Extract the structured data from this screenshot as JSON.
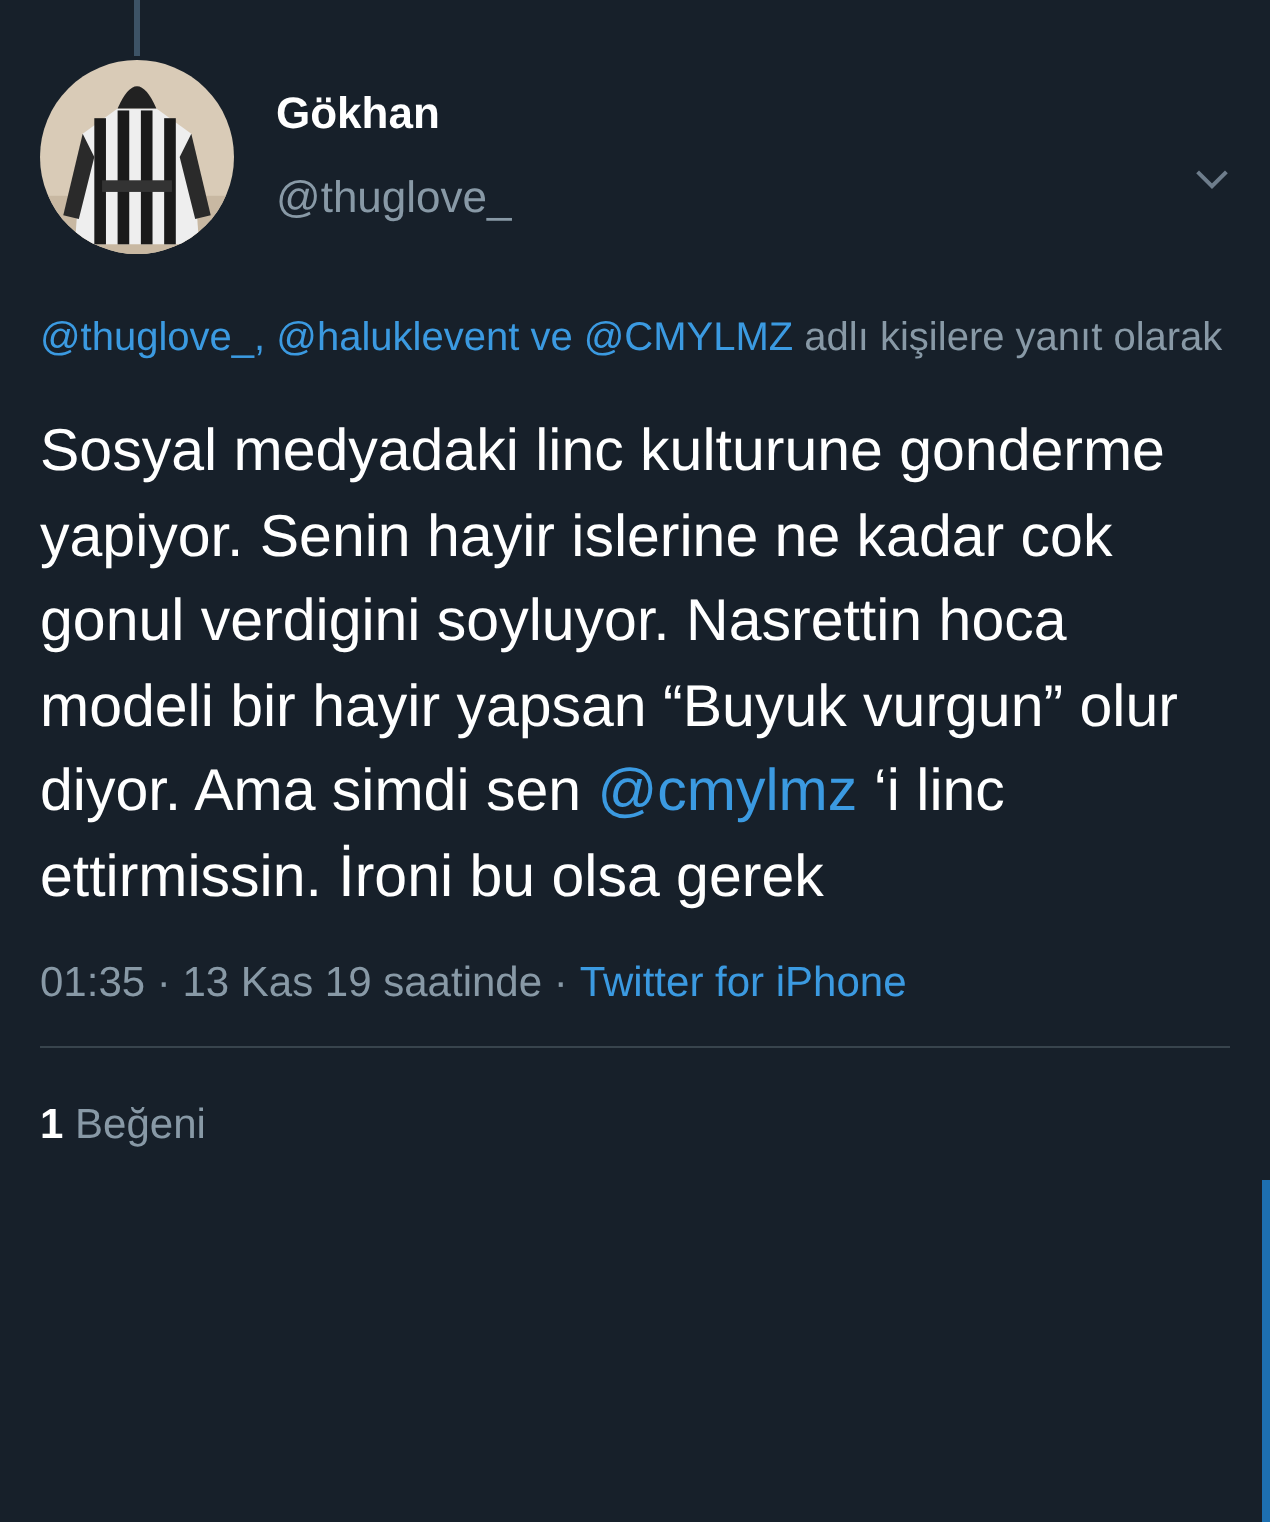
{
  "author": {
    "name": "Gökhan",
    "handle": "@thuglove_"
  },
  "reply_to": [
    {
      "kind": "mention",
      "text": "@thuglove_, @haluklevent ve @CMYLMZ"
    },
    {
      "kind": "text",
      "text": " adlı kişilere yanıt olarak"
    }
  ],
  "body": [
    {
      "kind": "text",
      "text": "Sosyal medyadaki linc kulturune gonderme yapiyor. Senin hayir islerine ne kadar cok gonul verdigini soyluyor. Nasrettin hoca modeli bir hayir yapsan “Buyuk vurgun” olur diyor. Ama simdi sen "
    },
    {
      "kind": "mention",
      "text": "@cmylmz"
    },
    {
      "kind": "text",
      "text": " ‘i linc ettirmissin. İroni bu olsa gerek"
    }
  ],
  "meta": {
    "time": "01:35 · 13 Kas 19 saatinde ·",
    "source": "Twitter for iPhone"
  },
  "likes": {
    "count": "1",
    "label": "Beğeni"
  }
}
